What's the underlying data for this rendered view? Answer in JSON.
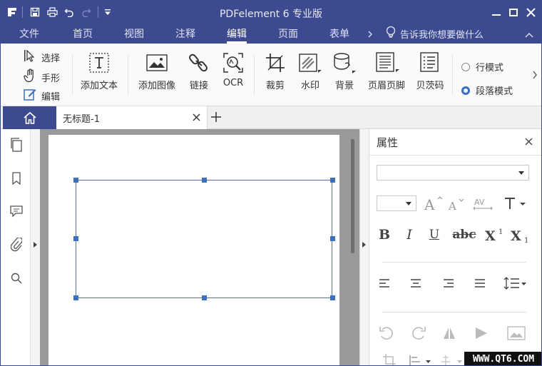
{
  "window": {
    "title": "PDFelement  6 专业版"
  },
  "menu": {
    "items": [
      "文件",
      "首页",
      "视图",
      "注释",
      "编辑",
      "页面",
      "表单"
    ],
    "active": "编辑",
    "tell_me": "告诉我你想要做什么"
  },
  "ribbon": {
    "select": "选择",
    "hand": "手形",
    "edit": "编辑",
    "add_text": "添加文本",
    "add_image": "添加图像",
    "link": "链接",
    "ocr": "OCR",
    "crop": "裁剪",
    "watermark": "水印",
    "background": "背景",
    "header_footer": "页眉页脚",
    "bates": "贝茨码",
    "line_mode": "行模式",
    "paragraph_mode": "段落模式",
    "selected_mode": "段落模式"
  },
  "tabs": {
    "doc_title": "无标题-1"
  },
  "properties": {
    "title": "属性",
    "font_value": "",
    "size_value": ""
  },
  "overlay": {
    "site_watermark": "WWW.QT6.COM"
  },
  "colors": {
    "brand": "#3d4a8f",
    "handle": "#3a6fc1"
  }
}
